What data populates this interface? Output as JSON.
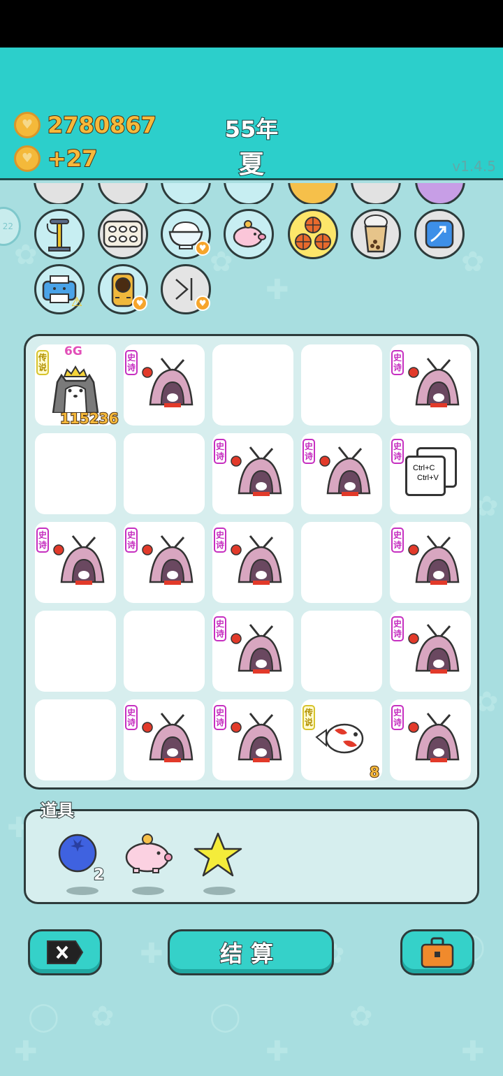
{
  "header": {
    "coins": "2780867",
    "coin_rate": "+27",
    "year": "55年",
    "season": "夏",
    "version": "v1.4.5"
  },
  "side_tab": {
    "label": "22"
  },
  "tools": [
    {
      "name": "air-pump-icon"
    },
    {
      "name": "egg-tray-icon"
    },
    {
      "name": "rice-bowl-icon"
    },
    {
      "name": "piggy-bank-icon"
    },
    {
      "name": "basketballs-icon"
    },
    {
      "name": "bubble-tea-icon"
    },
    {
      "name": "growth-arrow-icon"
    },
    {
      "name": "printer-icon"
    },
    {
      "name": "tiger-icon"
    },
    {
      "name": "skip-icon"
    }
  ],
  "board": {
    "tags": {
      "epic": "史诗",
      "legend": "传说"
    },
    "husky_level": "6G",
    "husky_score": "115236",
    "fish_count": "8",
    "copy_card": {
      "line1": "Ctrl+C",
      "line2": "Ctrl+V"
    }
  },
  "items": {
    "label": "道具",
    "blueberry_count": "2"
  },
  "buttons": {
    "settle": "结算"
  },
  "colors": {
    "header": "#2ccfcb",
    "background": "#a8dee0",
    "coin": "#f4b93a",
    "epic_tag": "#c62fc0",
    "legend_tag": "#d7c32b"
  }
}
